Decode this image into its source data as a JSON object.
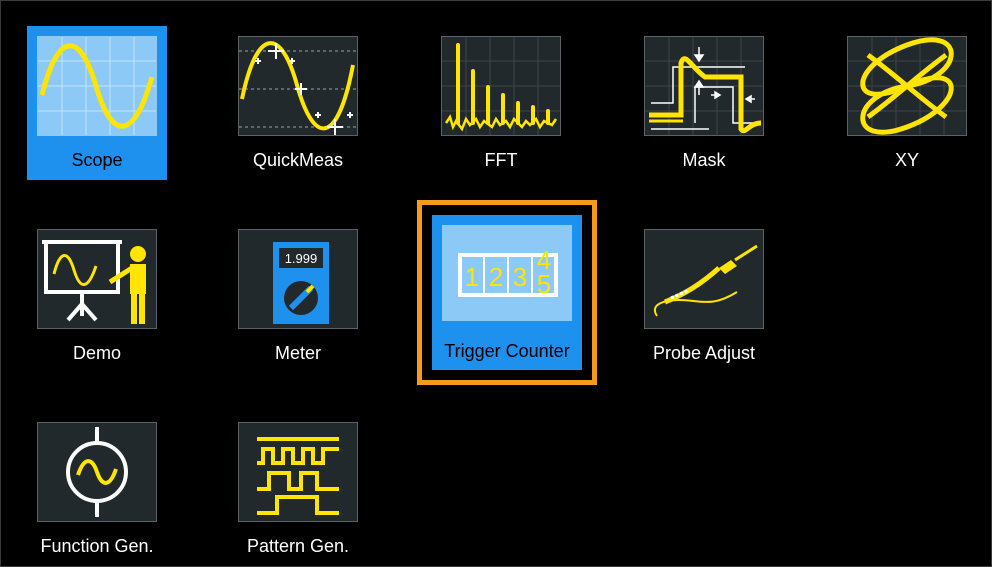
{
  "apps": {
    "scope": {
      "label": "Scope",
      "icon": "sine-wave-icon"
    },
    "quickmeas": {
      "label": "QuickMeas",
      "icon": "quick-measure-icon"
    },
    "fft": {
      "label": "FFT",
      "icon": "fft-spectrum-icon"
    },
    "mask": {
      "label": "Mask",
      "icon": "mask-test-icon"
    },
    "xy": {
      "label": "XY",
      "icon": "lissajous-icon"
    },
    "demo": {
      "label": "Demo",
      "icon": "presenter-icon"
    },
    "meter": {
      "label": "Meter",
      "icon": "multimeter-icon",
      "display_value": "1.999"
    },
    "trigger_counter": {
      "label": "Trigger Counter",
      "icon": "counter-icon",
      "digits": [
        "1",
        "2",
        "3",
        "4",
        "5"
      ]
    },
    "probe_adjust": {
      "label": "Probe Adjust",
      "icon": "probe-icon"
    },
    "function_gen": {
      "label": "Function Gen.",
      "icon": "function-generator-icon"
    },
    "pattern_gen": {
      "label": "Pattern Gen.",
      "icon": "pattern-generator-icon"
    }
  },
  "selected_app": "Scope",
  "focused_app": "Trigger Counter",
  "colors": {
    "accent": "#1e90ee",
    "focus": "#f59a1b",
    "trace": "#ffe500",
    "tile_bg": "#22292c"
  }
}
